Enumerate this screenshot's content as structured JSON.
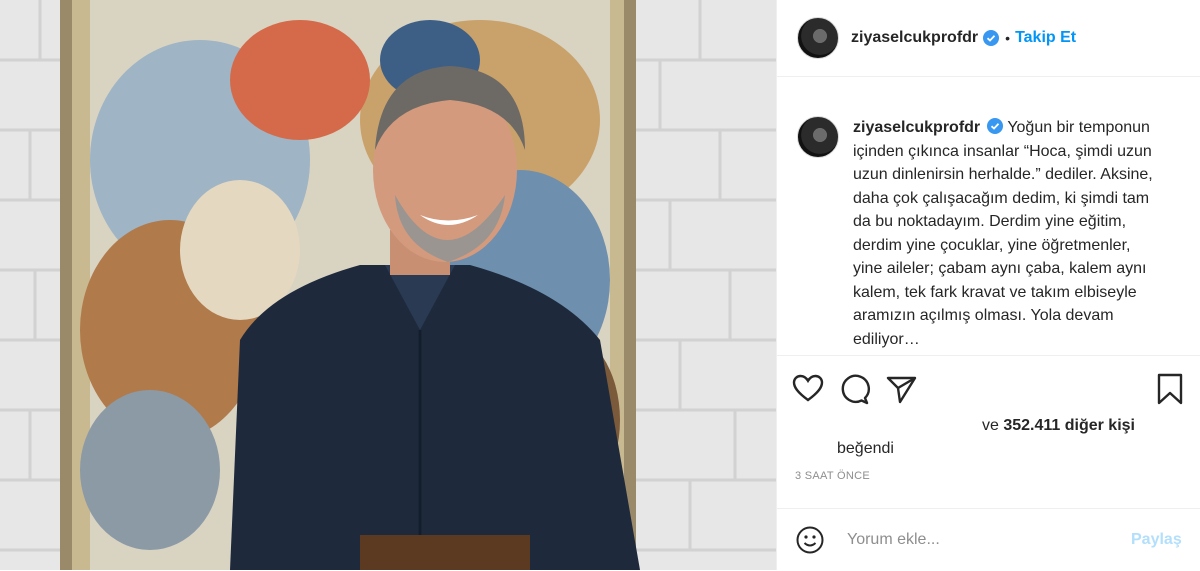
{
  "post": {
    "username": "ziyaselcukprofdr",
    "follow_label": "Takip Et",
    "separator": "•",
    "caption": "Yoğun bir temponun içinden çıkınca insanlar “Hoca, şimdi uzun uzun dinlenirsin herhalde.” dediler. Aksine, daha çok çalışacağım dedim, ki şimdi tam da bu noktadayım. Derdim yine eğitim, derdim yine çocuklar, yine öğretmenler, yine aileler; çabam aynı çaba, kalem aynı kalem, tek fark kravat ve takım elbiseyle aramızın açılmış olması. Yola devam ediliyor…",
    "likes_prefix": "ve ",
    "likes_count": "352.411 diğer kişi",
    "liked_label": "beğendi",
    "time_ago": "3 SAAT ÖNCE",
    "comment_placeholder": "Yorum ekle...",
    "share_label": "Paylaş"
  },
  "icons": {
    "like": "heart-icon",
    "comment": "comment-icon",
    "share": "paper-plane-icon",
    "save": "bookmark-icon",
    "emoji": "smiley-icon",
    "verified": "verified-badge-icon"
  },
  "colors": {
    "link_blue": "#0095f6",
    "share_disabled": "#b2dffc",
    "verified_blue": "#3897f0",
    "muted": "#8e8e8e"
  }
}
